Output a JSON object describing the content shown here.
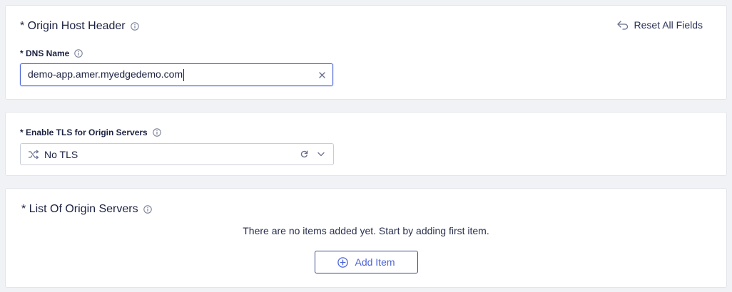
{
  "origin_host_header": {
    "title": "* Origin Host Header",
    "reset_label": "Reset All Fields",
    "dns_name": {
      "label": "* DNS Name",
      "value": "demo-app.amer.myedgedemo.com"
    }
  },
  "tls": {
    "label": "* Enable TLS for Origin Servers",
    "selected_value": "No TLS"
  },
  "origin_servers": {
    "title": "* List Of Origin Servers",
    "empty_message": "There are no items added yet. Start by adding first item.",
    "add_button_label": "Add Item"
  },
  "icons": {
    "info": "info-icon",
    "reset": "undo-arrow-icon",
    "clear": "close-icon",
    "tls": "shuffle-arrows-icon",
    "refresh": "refresh-icon",
    "dropdown": "chevron-down-icon",
    "add": "plus-circle-icon"
  },
  "colors": {
    "accent": "#4b63d8",
    "text": "#1b2140",
    "background": "#f1f2f5",
    "card": "#ffffff"
  }
}
